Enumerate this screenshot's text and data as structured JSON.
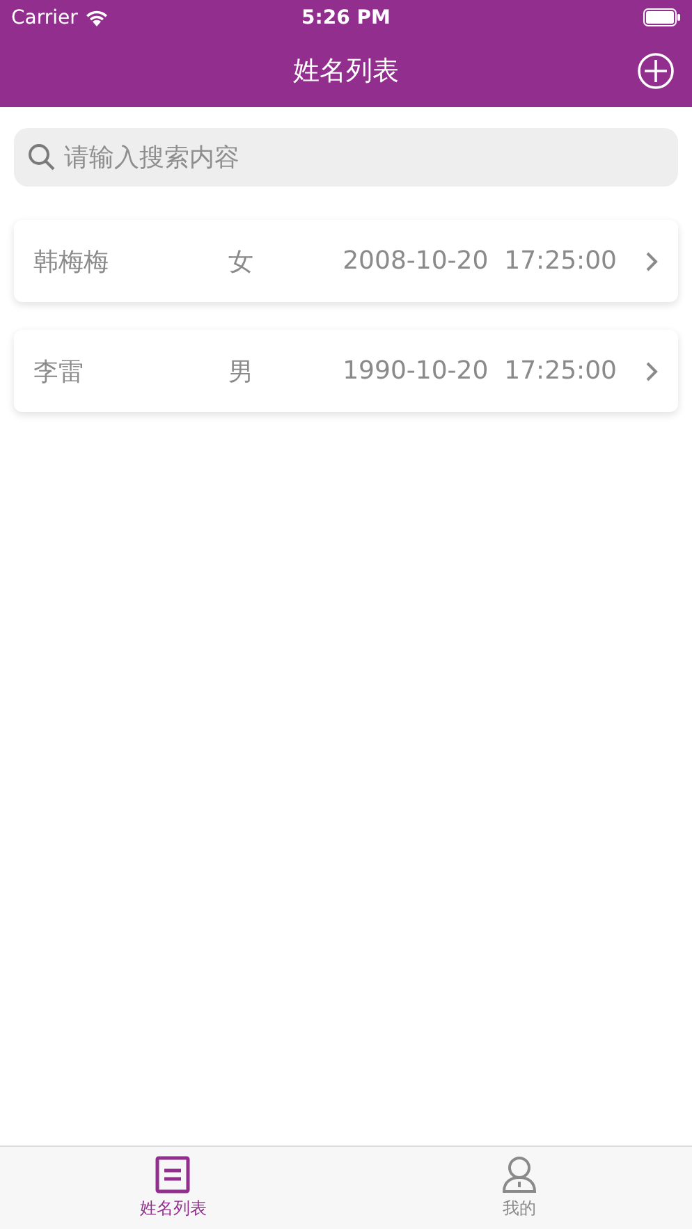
{
  "status_bar": {
    "carrier": "Carrier",
    "time": "5:26 PM"
  },
  "nav_bar": {
    "title": "姓名列表"
  },
  "search": {
    "placeholder": "请输入搜索内容"
  },
  "people": [
    {
      "name": "韩梅梅",
      "gender": "女",
      "datetime": "2008-10-20  17:25:00"
    },
    {
      "name": "李雷",
      "gender": "男",
      "datetime": "1990-10-20  17:25:00"
    }
  ],
  "tab_bar": [
    {
      "label": "姓名列表",
      "kind": "list",
      "selected": true
    },
    {
      "label": "我的",
      "kind": "person",
      "selected": false
    }
  ]
}
